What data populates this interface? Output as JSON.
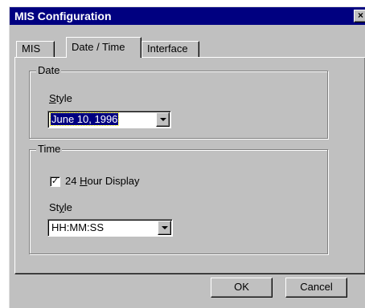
{
  "window": {
    "title": "MIS Configuration",
    "close_glyph": "×"
  },
  "tabs": [
    {
      "label": "MIS"
    },
    {
      "label": "Date / Time",
      "selected": true
    },
    {
      "label": "Interface"
    }
  ],
  "date_group": {
    "legend": "Date",
    "style_label_first": "S",
    "style_label_rest": "tyle",
    "style_value": "June 10, 1996"
  },
  "time_group": {
    "legend": "Time",
    "checkbox_checked": true,
    "checkbox_mark": "✓",
    "checkbox_label_pre": "24 ",
    "checkbox_label_ul": "H",
    "checkbox_label_post": "our Display",
    "style_label_pre": "St",
    "style_label_ul": "y",
    "style_label_post": "le",
    "style_value": "HH:MM:SS"
  },
  "buttons": {
    "ok": "OK",
    "cancel": "Cancel"
  },
  "icons": {
    "combo_arrow": "chevron-down-icon",
    "close": "close-icon"
  }
}
